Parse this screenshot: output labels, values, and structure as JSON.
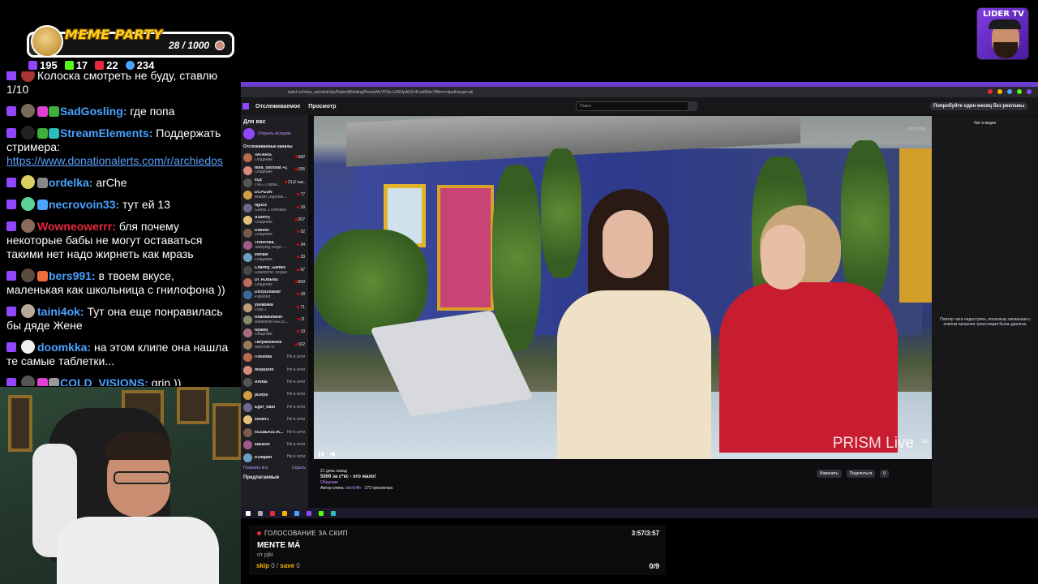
{
  "meme_party": {
    "title": "MEME PARTY",
    "count": "28 / 1000",
    "progress_fraction": 0.028
  },
  "stats": [
    {
      "icon": "twitch-icon",
      "value": "195",
      "color": "#9146ff"
    },
    {
      "icon": "kick-icon",
      "value": "17",
      "color": "#53fc18"
    },
    {
      "icon": "vk-live-icon",
      "value": "22",
      "color": "#e8283c"
    },
    {
      "icon": "viewers-icon",
      "value": "234",
      "color": "#4aa3ff"
    }
  ],
  "chat": [
    {
      "user": "",
      "user_color": "#ffffff",
      "text": "Колоска смотреть не буду, ставлю 1/10",
      "partial": true
    },
    {
      "user": "SadGosling:",
      "user_color": "#4aa3ff",
      "text": " где попа"
    },
    {
      "user": "StreamElements:",
      "user_color": "#4aa3ff",
      "text": " Поддержать стримера: ",
      "link": "https://www.donationalerts.com/r/archiedos"
    },
    {
      "user": "ordelka:",
      "user_color": "#4aa3ff",
      "text": " arChe"
    },
    {
      "user": "necrovoin33:",
      "user_color": "#4aa3ff",
      "text": " тут ей 13"
    },
    {
      "user": "Wowneowerrr:",
      "user_color": "#e8283c",
      "text": " бля почему некоторые бабы не могут оставаться такими нет надо жирнеть как мразь"
    },
    {
      "user": "bers991:",
      "user_color": "#4aa3ff",
      "text": " в твоем вкусе, маленькая как школьница с гнилофона ))"
    },
    {
      "user": "taini4ok:",
      "user_color": "#4aa3ff",
      "text": " Тут она еще понравилась бы дяде Жене"
    },
    {
      "user": "doomkka:",
      "user_color": "#4aa3ff",
      "text": " на этом клипе она нашла те самые таблетки..."
    },
    {
      "user": "COLD_VISIONS:",
      "user_color": "#4aa3ff",
      "text": " grin ))"
    }
  ],
  "browser": {
    "url": "twitch.tv/mira_ostrolist/clip/PatientBlindingPhoneWeYFNo-UZtiOpA5Zv4Lwk8bbc?filter=clips&range=all",
    "nav": [
      "Отслеживаемое",
      "Просмотр"
    ],
    "search_placeholder": "Поиск",
    "ad_text": "Попробуйте один месяц без рекламы"
  },
  "sidebar": {
    "heading": "Для вас",
    "history": "Открыть историю",
    "followed": "Отслеживаемые каналы",
    "channels": [
      {
        "name": "VATARIS",
        "cat": "Общение",
        "viewers": "582",
        "live": true
      },
      {
        "name": "mira_ostrolist +1",
        "cat": "Общение",
        "viewers": "155",
        "live": true
      },
      {
        "name": "xQc",
        "cat": "YRG Cobble...",
        "viewers": "21,6 тыс.",
        "live": true
      },
      {
        "name": "DCPGUN",
        "cat": "Mobile Legends...",
        "viewers": "77",
        "live": true
      },
      {
        "name": "ngizzz",
        "cat": "Gothic 1 Remake",
        "viewers": "18",
        "live": true
      },
      {
        "name": "A1berry",
        "cat": "Общение",
        "viewers": "207",
        "live": true
      },
      {
        "name": "Dokenz",
        "cat": "Общение",
        "viewers": "52",
        "live": true
      },
      {
        "name": "Troiechka_",
        "cat": "Sleeping Dogs:...",
        "viewers": "34",
        "live": true
      },
      {
        "name": "evelale",
        "cat": "Общение",
        "viewers": "33",
        "live": true
      },
      {
        "name": "Charmy_Games",
        "cat": "Deadzone: Rogue",
        "viewers": "97",
        "live": true
      },
      {
        "name": "Di_RUBENS",
        "cat": "Общение",
        "viewers": "669",
        "live": true
      },
      {
        "name": "DizzyDizaster",
        "cat": "Palworld",
        "viewers": "18",
        "live": true
      },
      {
        "name": "yuliabaka",
        "cat": "Dota 2",
        "viewers": "71",
        "live": true
      },
      {
        "name": "RealNakihaller",
        "cat": "Battlefield REDS...",
        "viewers": "11",
        "live": true
      },
      {
        "name": "Nyakkj",
        "cat": "Общение",
        "viewers": "13",
        "live": true
      },
      {
        "name": "TanyaBelkova",
        "cat": "Warcraft III",
        "viewers": "102",
        "live": true
      },
      {
        "name": "iTeeshka",
        "cat": "",
        "viewers": "Не в сети",
        "live": false
      },
      {
        "name": "mollbzero",
        "cat": "",
        "viewers": "Не в сети",
        "live": false
      },
      {
        "name": "Arthas",
        "cat": "",
        "viewers": "Не в сети",
        "live": false
      },
      {
        "name": "pulitya",
        "cat": "",
        "viewers": "Не в сети",
        "live": false
      },
      {
        "name": "Egor_Nast",
        "cat": "",
        "viewers": "Не в сети",
        "live": false
      },
      {
        "name": "silider1",
        "cat": "",
        "viewers": "Не в сети",
        "live": false
      },
      {
        "name": "xUZBEKISTA...",
        "cat": "",
        "viewers": "Не в сети",
        "live": false
      },
      {
        "name": "sasavot",
        "cat": "",
        "viewers": "Не в сети",
        "live": false
      },
      {
        "name": "lr1napart",
        "cat": "",
        "viewers": "Не в сети",
        "live": false
      }
    ],
    "show_all": "Показать все",
    "hide": "Скрыть",
    "recommended": "Предлагаемые"
  },
  "video": {
    "watermark": "PRISM Live",
    "corner_num": "28",
    "rtx": "RTX VSR"
  },
  "clip": {
    "age": "21 день назад",
    "title": "5000 за с*кс - это мало!",
    "category": "Общение",
    "author_label": "Автор клипа:",
    "author": "alex54th",
    "views": "· 272 просмотра",
    "edit": "Изменить",
    "share": "Поделиться",
    "likes": "0"
  },
  "right_panel": {
    "title": "Чат в видео",
    "message": "Повтор чата недоступен, поскольку связанная с клипом прошлая трансляция была удалена."
  },
  "vote": {
    "heading": "ГОЛОСОВАНИЕ ЗА СКИП",
    "time": "3:57/3:57",
    "track": "MENTE MÁ",
    "by": "от pjkt",
    "skip_label": "skip",
    "skip_count": "0",
    "save_label": "save",
    "save_count": "0",
    "total": "0/9"
  },
  "logo": {
    "title": "LIDER TV"
  }
}
